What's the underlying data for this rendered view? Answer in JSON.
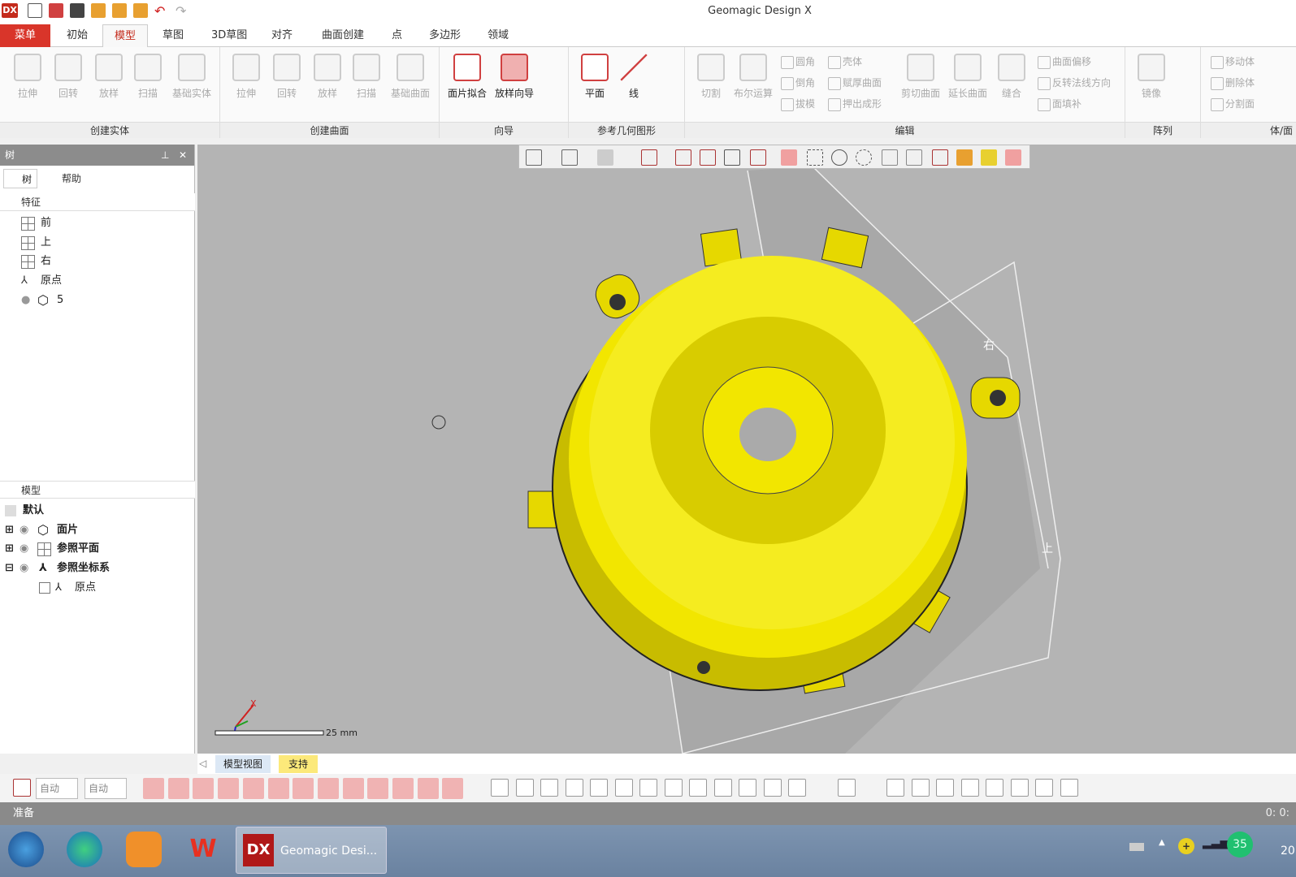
{
  "app": {
    "title": "Geomagic Design X",
    "logo": "DX"
  },
  "tabs": [
    {
      "label": "菜单"
    },
    {
      "label": "初始"
    },
    {
      "label": "模型",
      "active": true
    },
    {
      "label": "草图"
    },
    {
      "label": "3D草图"
    },
    {
      "label": "对齐"
    },
    {
      "label": "曲面创建"
    },
    {
      "label": "点"
    },
    {
      "label": "多边形"
    },
    {
      "label": "领域"
    }
  ],
  "ribbon": {
    "create_solid": {
      "label": "创建实体",
      "buttons": [
        "拉伸",
        "回转",
        "放样",
        "扫描",
        "基础实体"
      ]
    },
    "create_surface": {
      "label": "创建曲面",
      "buttons": [
        "拉伸",
        "回转",
        "放样",
        "扫描",
        "基础曲面"
      ]
    },
    "wizard": {
      "label": "向导",
      "buttons": [
        "面片拟合",
        "放样向导"
      ]
    },
    "ref_geometry": {
      "label": "参考几何图形",
      "buttons": [
        "平面",
        "线"
      ]
    },
    "edit": {
      "label": "编辑",
      "buttons": [
        "切割",
        "布尔运算",
        "剪切曲面",
        "延长曲面",
        "缝合"
      ],
      "small": [
        "圆角",
        "倒角",
        "拔模",
        "壳体",
        "赋厚曲面",
        "押出成形",
        "曲面偏移",
        "反转法线方向",
        "面填补"
      ]
    },
    "pattern": {
      "label": "阵列",
      "buttons": [
        "镜像"
      ]
    },
    "body_face": {
      "label": "体/面",
      "small": [
        "移动体",
        "删除体",
        "分割面"
      ]
    }
  },
  "tree_panel": {
    "title": "树",
    "tabs": [
      "树",
      "帮助"
    ],
    "features_header": "特征",
    "features": [
      "前",
      "上",
      "右",
      "原点",
      "5"
    ],
    "model_header": "模型",
    "model_items": [
      "默认",
      "面片",
      "参照平面",
      "参照坐标系",
      "原点"
    ]
  },
  "viewport": {
    "scale_label": "25 mm",
    "plane_labels": [
      "右",
      "上"
    ],
    "model_color": "#f2e600",
    "axis_x": "X"
  },
  "view_tabs": [
    "模型视图",
    "支持"
  ],
  "bottom_toolbar": {
    "combo1": "自动",
    "combo2": "自动"
  },
  "status": {
    "text": "准备",
    "right": "0: 0:"
  },
  "taskbar": {
    "active_app": "Geomagic Desi...",
    "tray_badge": "35",
    "clock_partial": "20"
  }
}
